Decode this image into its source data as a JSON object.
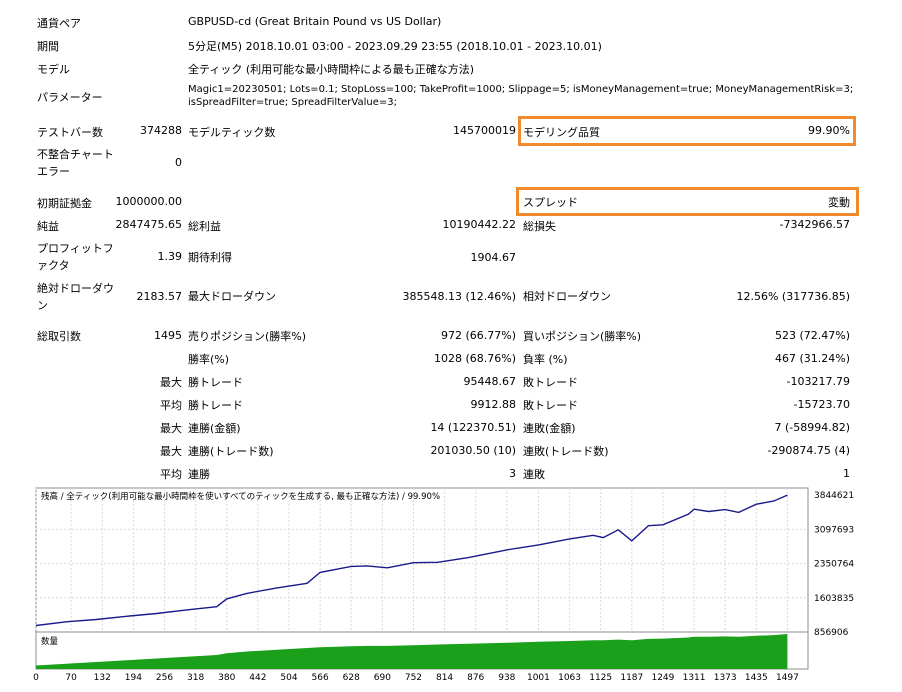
{
  "header": {
    "currency_label": "通貨ペア",
    "currency_value": "GBPUSD-cd (Great Britain Pound vs US Dollar)",
    "period_label": "期間",
    "period_value": "5分足(M5) 2018.10.01 03:00 - 2023.09.29 23:55 (2018.10.01 - 2023.10.01)",
    "model_label": "モデル",
    "model_value": "全ティック (利用可能な最小時間枠による最も正確な方法)",
    "params_label": "パラメーター",
    "params_line1": "Magic1=20230501; Lots=0.1; StopLoss=100; TakeProfit=1000; Slippage=5; isMoneyManagement=true; MoneyManagementRisk=3;",
    "params_line2": "isSpreadFilter=true; SpreadFilterValue=3;"
  },
  "stats": {
    "test_bars_label": "テストバー数",
    "test_bars_value": "374288",
    "model_ticks_label": "モデルティック数",
    "model_ticks_value": "145700019",
    "modeling_quality_label": "モデリング品質",
    "modeling_quality_value": "99.90%",
    "mismatch_label_1": "不整合チャート",
    "mismatch_label_2": "エラー",
    "mismatch_value": "0",
    "initial_deposit_label": "初期証拠金",
    "initial_deposit_value": "1000000.00",
    "spread_label": "スプレッド",
    "spread_value": "変動",
    "net_profit_label": "純益",
    "net_profit_value": "2847475.65",
    "gross_profit_label": "総利益",
    "gross_profit_value": "10190442.22",
    "gross_loss_label": "総損失",
    "gross_loss_value": "-7342966.57",
    "profit_factor_label_1": "プロフィットフ",
    "profit_factor_label_2": "ァクタ",
    "profit_factor_value": "1.39",
    "expected_payoff_label": "期待利得",
    "expected_payoff_value": "1904.67",
    "abs_drawdown_label_1": "絶対ドローダウ",
    "abs_drawdown_label_2": "ン",
    "abs_drawdown_value": "2183.57",
    "max_drawdown_label": "最大ドローダウン",
    "max_drawdown_value": "385548.13 (12.46%)",
    "rel_drawdown_label": "相対ドローダウン",
    "rel_drawdown_value": "12.56% (317736.85)",
    "total_trades_label": "総取引数",
    "total_trades_value": "1495",
    "short_pos_label": "売りポジション(勝率%)",
    "short_pos_value": "972 (66.77%)",
    "long_pos_label": "買いポジション(勝率%)",
    "long_pos_value": "523 (72.47%)",
    "win_rate_label": "勝率(%)",
    "win_rate_value": "1028 (68.76%)",
    "loss_rate_label": "負率 (%)",
    "loss_rate_value": "467 (31.24%)",
    "max_label": "最大",
    "avg_label": "平均",
    "win_trade_label": "勝トレード",
    "loss_trade_label": "敗トレード",
    "max_win_trade_value": "95448.67",
    "max_loss_trade_value": "-103217.79",
    "avg_win_trade_value": "9912.88",
    "avg_loss_trade_value": "-15723.70",
    "consec_win_amount_label": "連勝(金額)",
    "consec_win_amount_value": "14 (122370.51)",
    "consec_loss_amount_label": "連敗(金額)",
    "consec_loss_amount_value": "7 (-58994.82)",
    "consec_win_count_label": "連勝(トレード数)",
    "consec_win_count_value": "201030.50 (10)",
    "consec_loss_count_label": "連敗(トレード数)",
    "consec_loss_count_value": "-290874.75 (4)",
    "avg_consec_win_label": "連勝",
    "avg_consec_win_value": "3",
    "avg_consec_loss_label": "連敗",
    "avg_consec_loss_value": "1"
  },
  "chart_data": {
    "type": "line",
    "title": "残高 / 全ティック(利用可能な最小時間枠を使いすべてのティックを生成する, 最も正確な方法) / 99.90%",
    "lot_panel_label": "数量",
    "colors": {
      "balance": "#1a1a8c",
      "lot": "#1aa01a"
    },
    "y_ticks": [
      3844621,
      3097693,
      2350764,
      1603835,
      856906
    ],
    "x_ticks": [
      0,
      70,
      132,
      194,
      256,
      318,
      380,
      442,
      504,
      566,
      628,
      690,
      752,
      814,
      876,
      938,
      1001,
      1063,
      1125,
      1187,
      1249,
      1311,
      1373,
      1435,
      1497
    ],
    "xlim": [
      0,
      1538
    ],
    "ylim": [
      856906,
      4003000
    ],
    "x": [
      0,
      60,
      120,
      180,
      240,
      300,
      360,
      380,
      420,
      480,
      540,
      566,
      628,
      660,
      700,
      752,
      800,
      860,
      938,
      1001,
      1063,
      1110,
      1130,
      1160,
      1187,
      1220,
      1249,
      1300,
      1311,
      1340,
      1373,
      1400,
      1435,
      1470,
      1497
    ],
    "balance": [
      1000000,
      1080000,
      1130000,
      1200000,
      1260000,
      1340000,
      1410000,
      1580000,
      1700000,
      1820000,
      1920000,
      2160000,
      2290000,
      2300000,
      2260000,
      2370000,
      2380000,
      2480000,
      2650000,
      2760000,
      2890000,
      2970000,
      2920000,
      3090000,
      2850000,
      3180000,
      3200000,
      3430000,
      3540000,
      3490000,
      3530000,
      3470000,
      3650000,
      3720000,
      3847000
    ],
    "lot": [
      0.1,
      0.15,
      0.2,
      0.25,
      0.3,
      0.35,
      0.4,
      0.45,
      0.5,
      0.55,
      0.6,
      0.62,
      0.65,
      0.66,
      0.66,
      0.68,
      0.7,
      0.72,
      0.75,
      0.78,
      0.8,
      0.82,
      0.82,
      0.84,
      0.82,
      0.86,
      0.87,
      0.9,
      0.92,
      0.92,
      0.93,
      0.92,
      0.95,
      0.97,
      1.0
    ]
  }
}
